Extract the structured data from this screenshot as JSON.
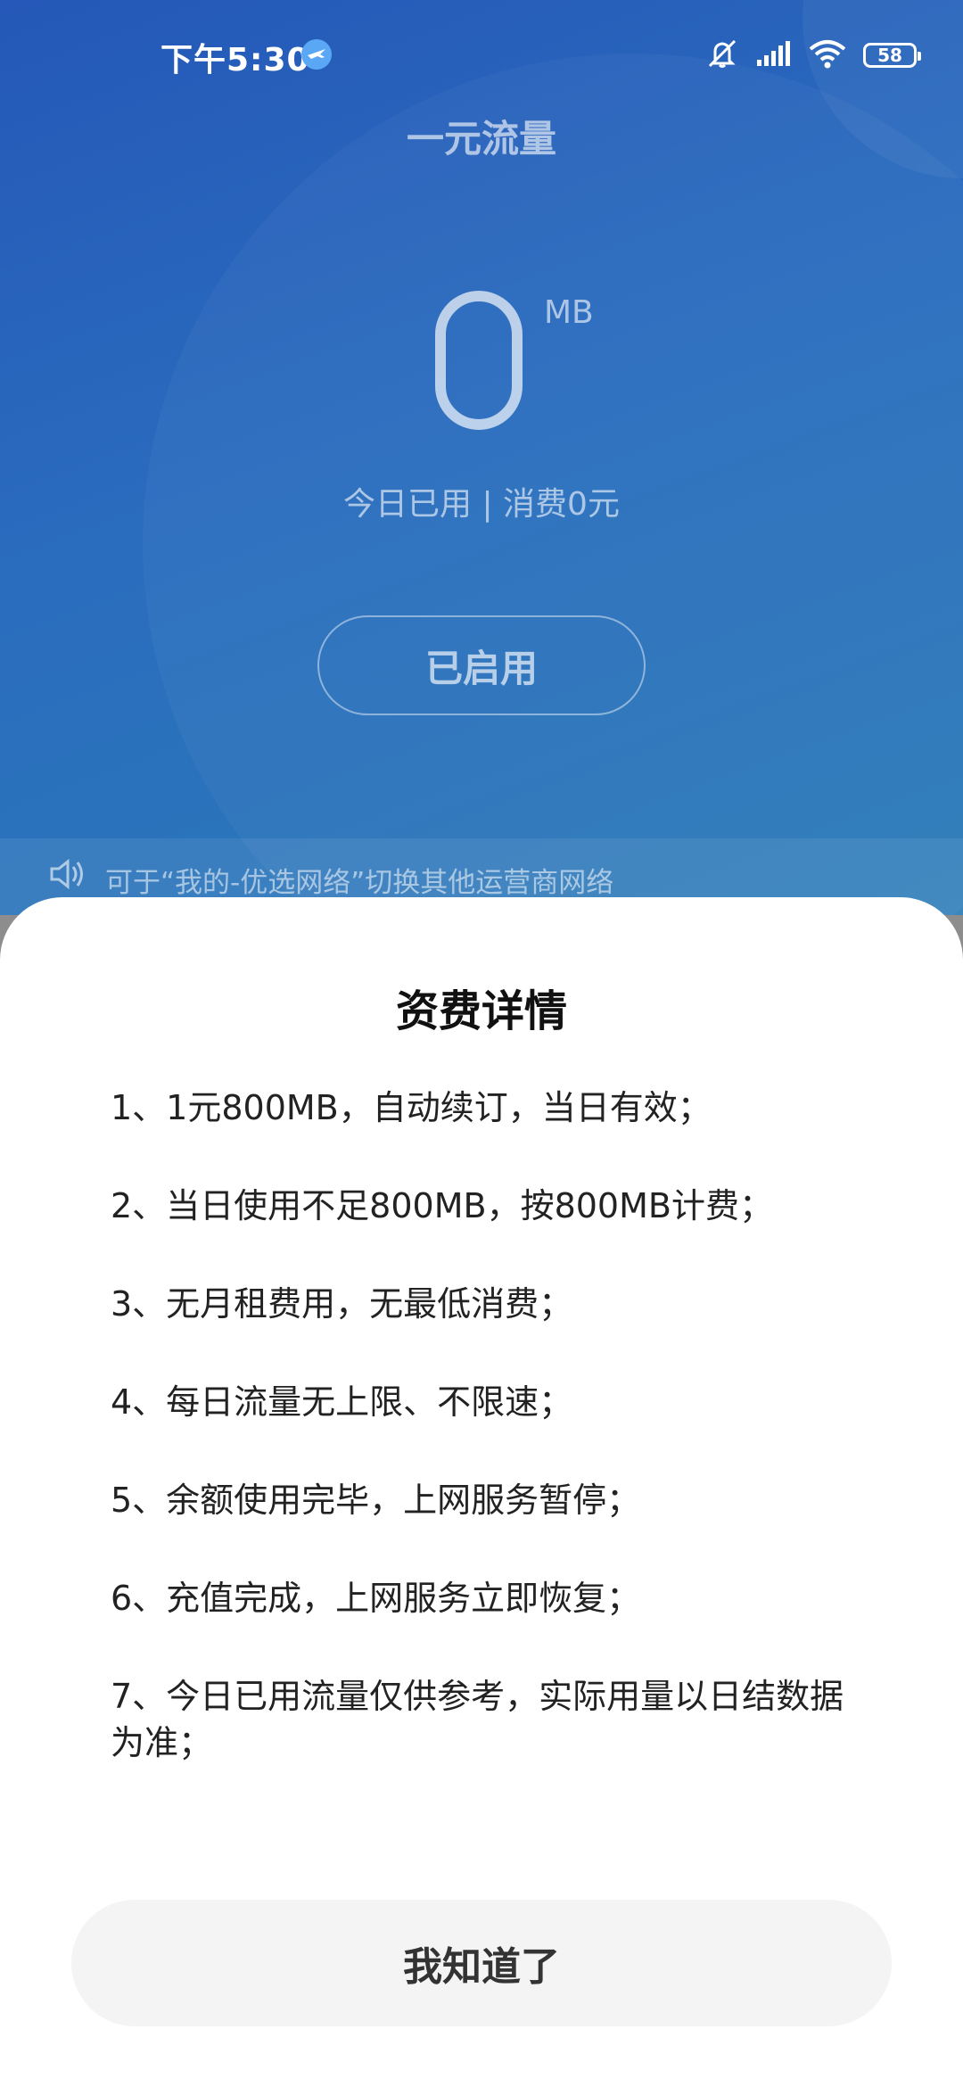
{
  "status_bar": {
    "time": "下午5:30",
    "battery": "58"
  },
  "app": {
    "title": "一元流量",
    "usage_value": "0",
    "usage_unit": "MB",
    "usage_subtitle": "今日已用 | 消费0元",
    "enabled_label": "已启用",
    "notice": "可于“我的-优选网络”切换其他运营商网络"
  },
  "sheet": {
    "title": "资费详情",
    "items": [
      "1、1元800MB，自动续订，当日有效；",
      "2、当日使用不足800MB，按800MB计费；",
      "3、无月租费用，无最低消费；",
      "4、每日流量无上限、不限速；",
      "5、余额使用完毕，上网服务暂停；",
      "6、充值完成，上网服务立即恢复；",
      "7、今日已用流量仅供参考，实际用量以日结数据为准；"
    ],
    "confirm_label": "我知道了"
  },
  "colors": {
    "bg_blue": "#2a6cbe",
    "sheet_bg": "#ffffff",
    "button_bg": "#f4f4f4"
  }
}
